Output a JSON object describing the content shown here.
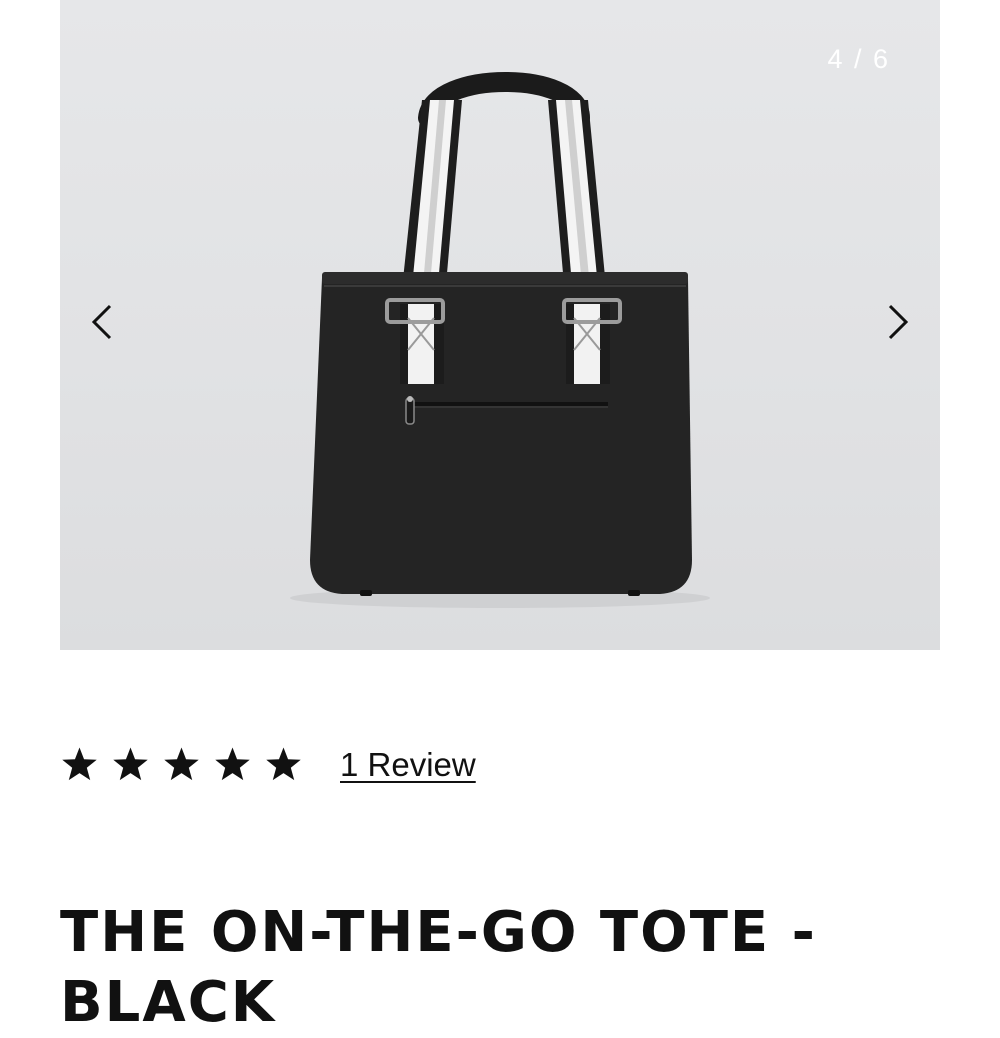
{
  "gallery": {
    "counter": "4 / 6",
    "image_alt": "The On-The-Go Tote in black, back view",
    "prev_icon": "chevron-left-icon",
    "next_icon": "chevron-right-icon"
  },
  "rating": {
    "stars": 5,
    "max_stars": 5,
    "star_icon": "star-icon",
    "review_link": "1 Review"
  },
  "product": {
    "title": "THE ON-THE-GO TOTE - BLACK"
  },
  "colors": {
    "text": "#111111",
    "image_background": "#e2e3e5"
  }
}
